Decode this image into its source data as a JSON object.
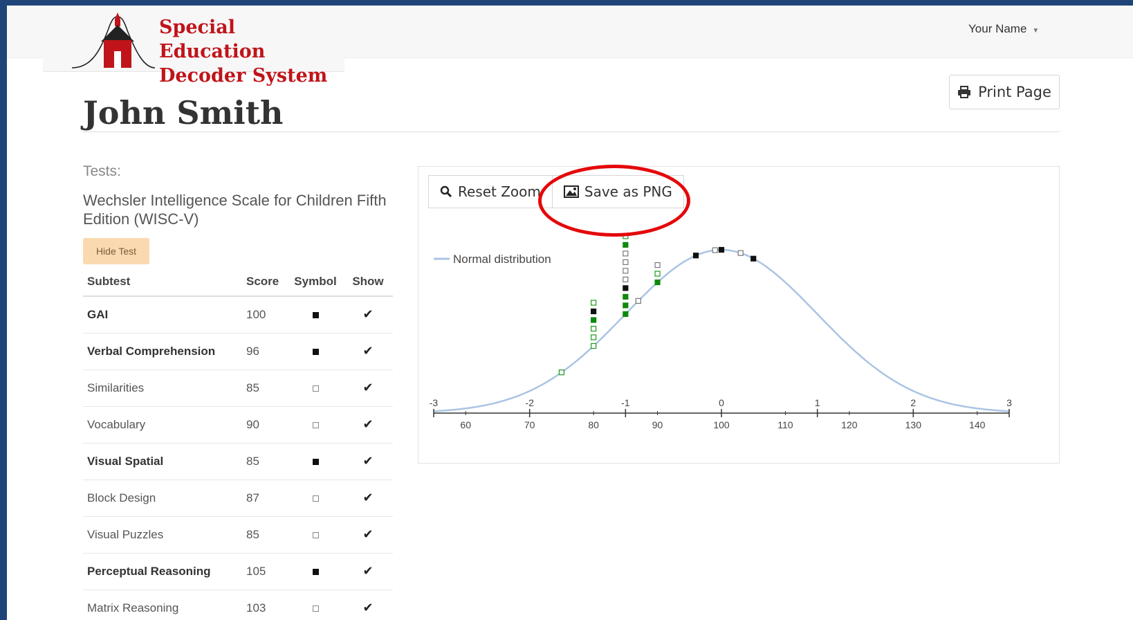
{
  "brand": {
    "line1": "Special Education",
    "line2": "Decoder System"
  },
  "user": {
    "name": "Your Name"
  },
  "print_button": {
    "label": "Print Page",
    "icon": "print-icon"
  },
  "page": {
    "title": "John Smith"
  },
  "tests": {
    "label": "Tests:",
    "name": "Wechsler Intelligence Scale for Children Fifth Edition (WISC-V)",
    "hide_label": "Hide Test",
    "columns": [
      "Subtest",
      "Score",
      "Symbol",
      "Show"
    ],
    "rows": [
      {
        "subtest": "GAI",
        "score": "100",
        "symbol": "filled",
        "bold": true,
        "show": "✔"
      },
      {
        "subtest": "Verbal Comprehension",
        "score": "96",
        "symbol": "filled",
        "bold": true,
        "show": "✔"
      },
      {
        "subtest": "Similarities",
        "score": "85",
        "symbol": "open",
        "bold": false,
        "show": "✔"
      },
      {
        "subtest": "Vocabulary",
        "score": "90",
        "symbol": "open",
        "bold": false,
        "show": "✔"
      },
      {
        "subtest": "Visual Spatial",
        "score": "85",
        "symbol": "filled",
        "bold": true,
        "show": "✔"
      },
      {
        "subtest": "Block Design",
        "score": "87",
        "symbol": "open",
        "bold": false,
        "show": "✔"
      },
      {
        "subtest": "Visual Puzzles",
        "score": "85",
        "symbol": "open",
        "bold": false,
        "show": "✔"
      },
      {
        "subtest": "Perceptual Reasoning",
        "score": "105",
        "symbol": "filled",
        "bold": true,
        "show": "✔"
      },
      {
        "subtest": "Matrix Reasoning",
        "score": "103",
        "symbol": "open",
        "bold": false,
        "show": "✔"
      }
    ]
  },
  "chart_toolbar": {
    "reset_zoom": "Reset Zoom",
    "save_png": "Save as PNG"
  },
  "chart_data": {
    "type": "line",
    "legend": "Normal distribution",
    "legend_position": "top-left",
    "curve_color": "#a9c4e3",
    "mean": 100,
    "sd": 15,
    "z_ticks": [
      "-3",
      "-2",
      "-1",
      "0",
      "1",
      "2",
      "3"
    ],
    "score_ticks": [
      "60",
      "70",
      "80",
      "90",
      "100",
      "110",
      "120",
      "130",
      "140"
    ],
    "xlim": [
      55,
      145
    ],
    "markers": [
      {
        "score": 75,
        "style": "green-open",
        "stack": 0
      },
      {
        "score": 80,
        "style": "green-open",
        "stack": 0
      },
      {
        "score": 80,
        "style": "green-open",
        "stack": 1
      },
      {
        "score": 80,
        "style": "green-open",
        "stack": 2
      },
      {
        "score": 80,
        "style": "green-filled",
        "stack": 3
      },
      {
        "score": 80,
        "style": "black-filled",
        "stack": 4
      },
      {
        "score": 80,
        "style": "green-open",
        "stack": 5
      },
      {
        "score": 85,
        "style": "green-filled",
        "stack": 0
      },
      {
        "score": 85,
        "style": "green-filled",
        "stack": 1
      },
      {
        "score": 85,
        "style": "green-filled",
        "stack": 2
      },
      {
        "score": 85,
        "style": "black-filled",
        "stack": 3
      },
      {
        "score": 85,
        "style": "gray-open",
        "stack": 4
      },
      {
        "score": 85,
        "style": "gray-open",
        "stack": 5
      },
      {
        "score": 85,
        "style": "gray-open",
        "stack": 6
      },
      {
        "score": 85,
        "style": "gray-open",
        "stack": 7
      },
      {
        "score": 85,
        "style": "green-filled",
        "stack": 8
      },
      {
        "score": 85,
        "style": "green-open",
        "stack": 9
      },
      {
        "score": 87,
        "style": "gray-open",
        "stack": 0
      },
      {
        "score": 90,
        "style": "green-filled",
        "stack": 0
      },
      {
        "score": 90,
        "style": "green-open",
        "stack": 1
      },
      {
        "score": 90,
        "style": "gray-open",
        "stack": 2
      },
      {
        "score": 96,
        "style": "black-filled",
        "stack": 0
      },
      {
        "score": 99,
        "style": "gray-open",
        "stack": 0
      },
      {
        "score": 100,
        "style": "black-filled",
        "stack": 0
      },
      {
        "score": 103,
        "style": "gray-open",
        "stack": 0
      },
      {
        "score": 105,
        "style": "black-filled",
        "stack": 0
      }
    ]
  }
}
